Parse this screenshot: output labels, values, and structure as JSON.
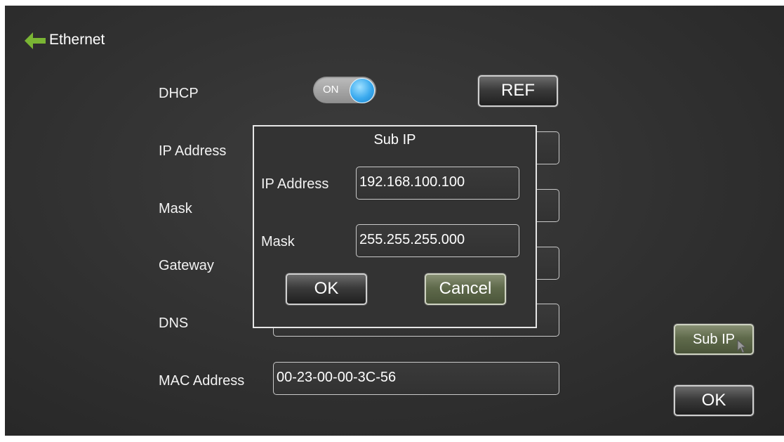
{
  "header": {
    "title": "Ethernet",
    "back_icon": "back-arrow-icon",
    "accent": "#7ab534"
  },
  "dhcp": {
    "label": "DHCP",
    "toggle_text": "ON",
    "state": true,
    "refresh_label": "REF"
  },
  "fields": {
    "ip_label": "IP Address",
    "mask_label": "Mask",
    "gateway_label": "Gateway",
    "dns_label": "DNS",
    "mac_label": "MAC Address",
    "mac_value": "00-23-00-00-3C-56"
  },
  "sub_ip_dialog": {
    "title": "Sub IP",
    "ip_label": "IP Address",
    "ip_value": "192.168.100.100",
    "mask_label": "Mask",
    "mask_value": "255.255.255.000",
    "ok_label": "OK",
    "cancel_label": "Cancel"
  },
  "side_buttons": {
    "sub_ip_label": "Sub IP",
    "ok_label": "OK"
  },
  "colors": {
    "toggle_knob": "#39a9ee",
    "olive_button": "#5f6a4b"
  }
}
